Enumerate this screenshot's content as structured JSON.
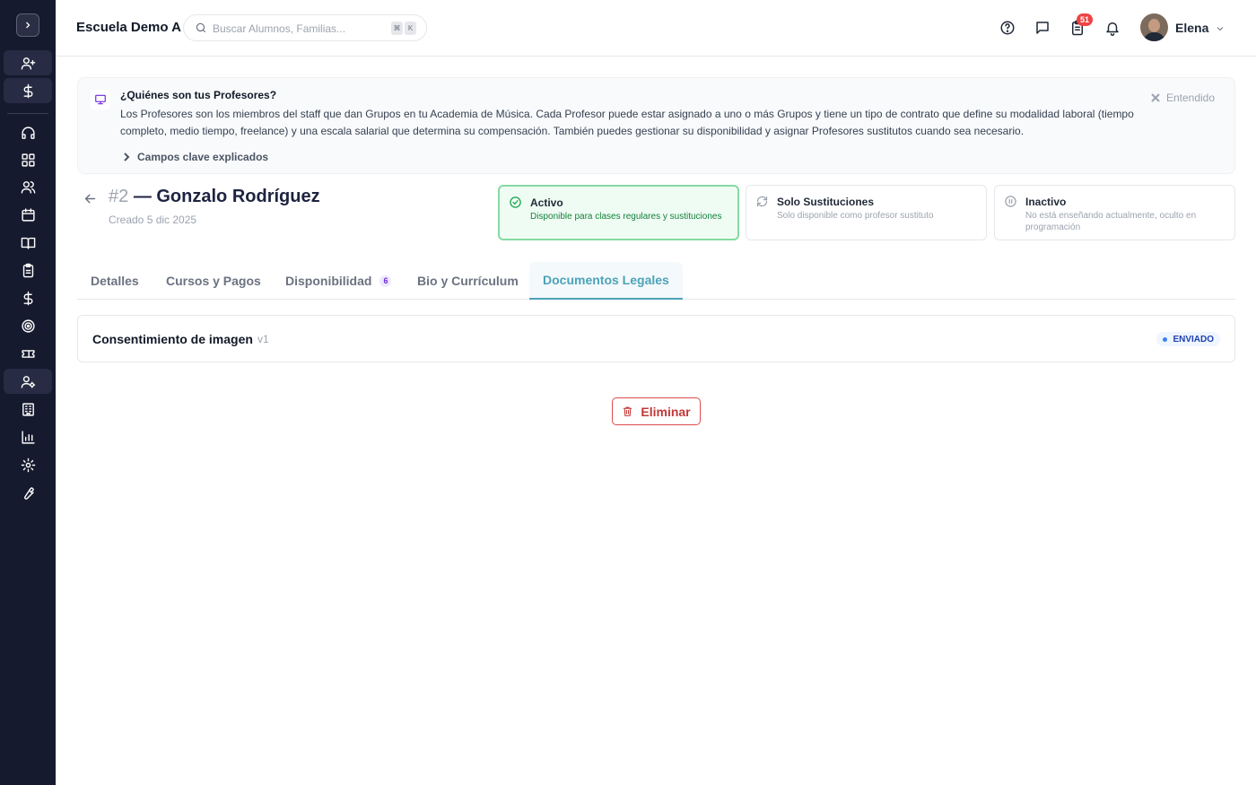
{
  "header": {
    "school_name": "Escuela Demo A",
    "search_placeholder": "Buscar Alumnos, Familias...",
    "shortcut_keys": [
      "⌘",
      "K"
    ],
    "tasks_badge": "51",
    "user_name": "Elena"
  },
  "sidebar": {
    "icons": [
      "user-plus-icon",
      "dollar-icon",
      "headset-icon",
      "dashboard-icon",
      "users-icon",
      "calendar-icon",
      "book-icon",
      "clipboard-icon",
      "dollar-icon",
      "target-icon",
      "ticket-icon",
      "user-settings-icon",
      "building-icon",
      "chart-icon",
      "gear-icon",
      "wrench-icon"
    ]
  },
  "banner": {
    "title": "¿Quiénes son tus Profesores?",
    "text": "Los Profesores son los miembros del staff que dan Grupos en tu Academia de Música. Cada Profesor puede estar asignado a uno o más Grupos y tiene un tipo de contrato que define su modalidad laboral (tiempo completo, medio tiempo, freelance) y una escala salarial que determina su compensación. También puedes gestionar su disponibilidad y asignar Profesores sustitutos cuando sea necesario.",
    "dismiss_label": "Entendido",
    "expand_label": "Campos clave explicados"
  },
  "teacher": {
    "number": "#2",
    "name": "— Gonzalo Rodríguez",
    "created": "Creado 5 dic 2025"
  },
  "statuses": [
    {
      "title": "Activo",
      "description": "Disponible para clases regulares y sustituciones",
      "selected": true
    },
    {
      "title": "Solo Sustituciones",
      "description": "Solo disponible como profesor sustituto",
      "selected": false
    },
    {
      "title": "Inactivo",
      "description": "No está enseñando actualmente, oculto en programación",
      "selected": false
    }
  ],
  "tabs": [
    {
      "label": "Detalles"
    },
    {
      "label": "Cursos y Pagos"
    },
    {
      "label": "Disponibilidad",
      "count": "6"
    },
    {
      "label": "Bio y Currículum"
    },
    {
      "label": "Documentos Legales",
      "active": true
    }
  ],
  "document": {
    "title": "Consentimiento de imagen",
    "version": "v1",
    "status": "ENVIADO"
  },
  "actions": {
    "delete_label": "Eliminar"
  },
  "colors": {
    "sidebar_bg": "#161a2e",
    "accent": "#4ba3b8",
    "active_status": "#86d9a3",
    "danger": "#dc4b4b"
  }
}
